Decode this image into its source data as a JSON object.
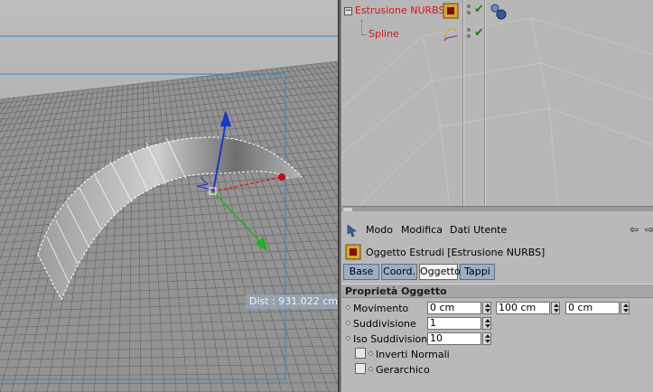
{
  "viewport": {
    "distance_readout": "Dist : 931.022 cm"
  },
  "object_manager": {
    "objects": [
      {
        "name": "Estrusione NURBS",
        "icon": "extrude-nurbs-icon",
        "expander": "−",
        "visible": "✔",
        "tag": "phong-tag-icon"
      },
      {
        "name": "Spline",
        "icon": "spline-icon",
        "visible": "✔"
      }
    ]
  },
  "attribute_manager": {
    "menu": [
      "Modo",
      "Modifica",
      "Dati Utente"
    ],
    "nav_back": "⇦",
    "nav_forward": "⇨",
    "object_title": "Oggetto Estrudi [Estrusione NURBS]",
    "tabs": [
      "Base",
      "Coord.",
      "Oggetto",
      "Tappi"
    ],
    "active_tab": "Oggetto",
    "section_title": "Proprietà Oggetto",
    "properties": {
      "movimento": {
        "label": "Movimento",
        "x": "0 cm",
        "y": "100 cm",
        "z": "0 cm"
      },
      "suddivisione": {
        "label": "Suddivisione",
        "value": "1"
      },
      "iso_suddivisione": {
        "label": "Iso Suddivisione",
        "value": "10"
      },
      "inverti_normali": {
        "label": "Inverti Normali",
        "checked": false
      },
      "gerarchico": {
        "label": "Gerarchico",
        "checked": false
      }
    }
  },
  "colors": {
    "object_name": "#d01818",
    "tab_inactive": "#9aaec6",
    "tab_active": "#f6f6f6",
    "axis_x": "#e02020",
    "axis_y": "#20b020",
    "axis_z": "#1838c8",
    "frame": "#2a8ac8"
  }
}
